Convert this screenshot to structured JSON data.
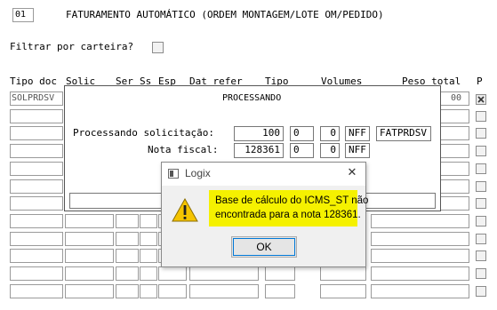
{
  "header": {
    "screen_code": "01",
    "title": "FATURAMENTO AUTOMÁTICO (ORDEM MONTAGEM/LOTE OM/PEDIDO)"
  },
  "filter": {
    "label": "Filtrar por carteira?",
    "checked": false
  },
  "grid": {
    "columns": [
      "Tipo doc",
      "Solic",
      "Ser",
      "Ss",
      "Esp",
      "Dat refer",
      "Tipo",
      "Volumes",
      "Peso total",
      "P"
    ],
    "first_row": {
      "tipo_doc": "SOLPRDSV",
      "peso_total": "00"
    }
  },
  "processing": {
    "title": "PROCESSANDO",
    "solicitacao_label": "Processando solicitação:",
    "solicitacao_value": "100",
    "solicitacao_a": "0",
    "solicitacao_b": "0",
    "solicitacao_type": "NFF",
    "solicitacao_code": "FATPRDSV",
    "nota_label": "Nota fiscal:",
    "nota_value": "128361",
    "nota_a": "0",
    "nota_b": "0",
    "nota_type": "NFF"
  },
  "dialog": {
    "title": "Logix",
    "icon": "warning-icon",
    "message_line1": "Base de cálculo do ICMS_ST não",
    "message_line2": "encontrada para a nota 128361.",
    "highlight_color": "#f5f100",
    "ok_label": "OK",
    "close_glyph": "✕"
  }
}
